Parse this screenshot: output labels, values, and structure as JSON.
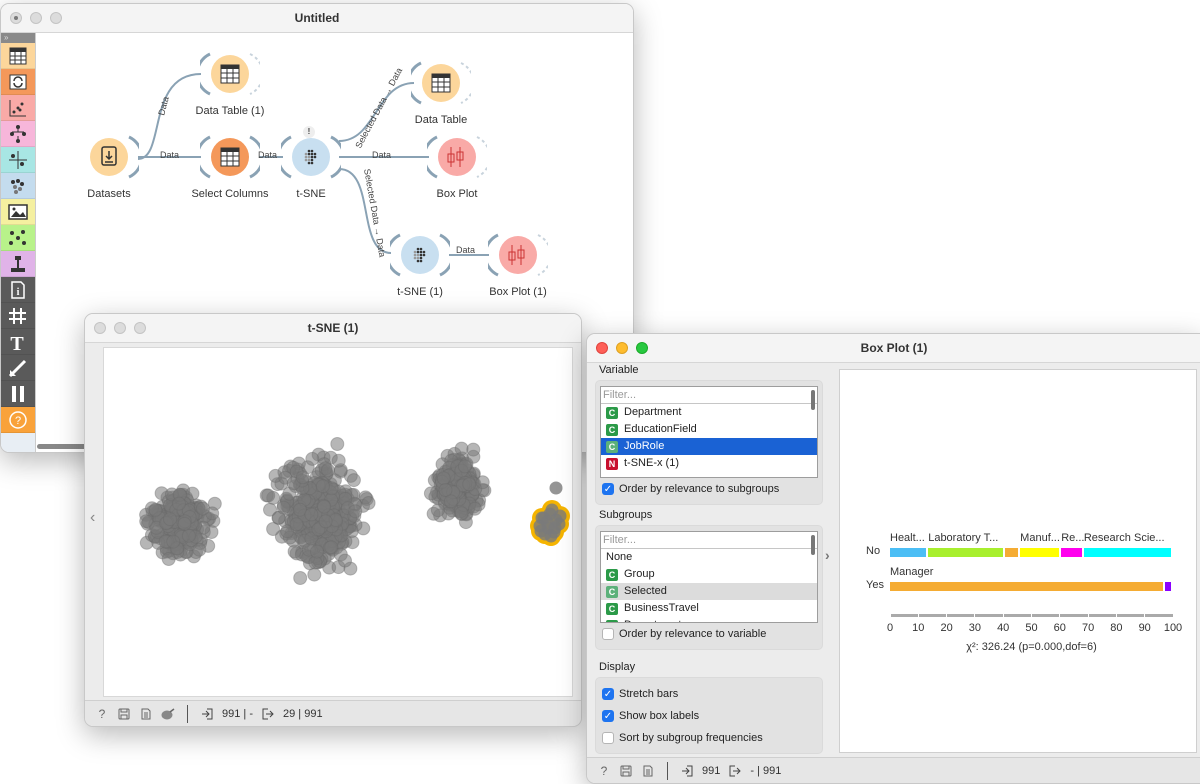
{
  "canvas_window": {
    "title": "Untitled",
    "toolbox_expand": "»",
    "toolbox_items": [
      {
        "name": "data-category",
        "color": "#fcd69b"
      },
      {
        "name": "transform-category",
        "color": "#f4985a"
      },
      {
        "name": "visualize-category",
        "color": "#f9aaa7"
      },
      {
        "name": "model-category",
        "color": "#f7b6da"
      },
      {
        "name": "evaluate-category",
        "color": "#a8e6e4"
      },
      {
        "name": "unsupervised-category",
        "color": "#c4dcee"
      },
      {
        "name": "image-category",
        "color": "#f5f0a0"
      },
      {
        "name": "network-category",
        "color": "#b8f28a"
      },
      {
        "name": "text-category",
        "color": "#e0b3e8"
      },
      {
        "name": "info",
        "color": "#5a5a5a"
      },
      {
        "name": "grid",
        "color": "#5a5a5a"
      },
      {
        "name": "text-annotation",
        "color": "#5a5a5a"
      },
      {
        "name": "arrow-annotation",
        "color": "#5a5a5a"
      },
      {
        "name": "pause",
        "color": "#5a5a5a"
      },
      {
        "name": "help",
        "color": "#f9a23a"
      }
    ],
    "nodes": [
      {
        "label": "Datasets",
        "color": "#fcd69b"
      },
      {
        "label": "Data Table (1)",
        "color": "#fcd69b"
      },
      {
        "label": "Select Columns",
        "color": "#f4985a"
      },
      {
        "label": "t-SNE",
        "color": "#c8dff0"
      },
      {
        "label": "Data Table",
        "color": "#fcd69b"
      },
      {
        "label": "Box Plot",
        "color": "#f9aaa7"
      },
      {
        "label": "t-SNE (1)",
        "color": "#c8dff0"
      },
      {
        "label": "Box Plot (1)",
        "color": "#f9aaa7"
      }
    ],
    "links": [
      {
        "label": "Data"
      },
      {
        "label": "Data"
      },
      {
        "label": "Data"
      },
      {
        "label": "Selected Data → Data"
      },
      {
        "label": "Data"
      },
      {
        "label": "Selected Data → Data"
      },
      {
        "label": "Data"
      }
    ],
    "warning_mark": "!"
  },
  "tsne_window": {
    "title": "t-SNE (1)",
    "side_arrow": "‹",
    "status": {
      "input_count": "991 | -",
      "output_count": "29 | 991"
    },
    "colors": {
      "point": "#7a7a7a",
      "selection": "#f5b400"
    }
  },
  "boxplot_window": {
    "title": "Box Plot (1)",
    "variable": {
      "title": "Variable",
      "filter_placeholder": "Filter...",
      "items": [
        {
          "type": "C",
          "label": "Department",
          "state": ""
        },
        {
          "type": "C",
          "label": "EducationField",
          "state": ""
        },
        {
          "type": "C",
          "label": "JobRole",
          "state": "selected"
        },
        {
          "type": "N",
          "label": "t-SNE-x (1)",
          "state": ""
        }
      ],
      "order_checkbox": {
        "label": "Order by relevance to subgroups",
        "checked": true
      }
    },
    "subgroups": {
      "title": "Subgroups",
      "filter_placeholder": "Filter...",
      "items": [
        {
          "type": "",
          "label": "None",
          "state": ""
        },
        {
          "type": "C",
          "label": "Group",
          "state": ""
        },
        {
          "type": "C",
          "label": "Selected",
          "state": "highlighted"
        },
        {
          "type": "C",
          "label": "BusinessTravel",
          "state": ""
        },
        {
          "type": "C",
          "label": "Department",
          "state": ""
        }
      ],
      "order_checkbox": {
        "label": "Order by relevance to variable",
        "checked": false
      }
    },
    "display": {
      "title": "Display",
      "options": [
        {
          "label": "Stretch bars",
          "checked": true
        },
        {
          "label": "Show box labels",
          "checked": true
        },
        {
          "label": "Sort by subgroup frequencies",
          "checked": false
        }
      ]
    },
    "expand_arrow": "›",
    "status": {
      "input_count": "991",
      "output_count": "- | 991"
    }
  },
  "chart_data": {
    "type": "bar",
    "orientation": "horizontal-stacked-percent",
    "categories": [
      "No",
      "Yes"
    ],
    "series": [
      {
        "name": "Healthcare Representative",
        "label": "Healt...",
        "color": "#4bbef5",
        "values": [
          13.5,
          0
        ]
      },
      {
        "name": "Laboratory Technician",
        "label": "Laboratory T...",
        "color": "#a8ef2e",
        "values": [
          27,
          0
        ]
      },
      {
        "name": "Manager",
        "label": "Manager",
        "color": "#f5ac33",
        "values": [
          5.5,
          97
        ]
      },
      {
        "name": "Manufacturing Director",
        "label": "Manuf...",
        "color": "#ffff00",
        "values": [
          14.5,
          0
        ]
      },
      {
        "name": "Research Director",
        "label": "Re...",
        "color": "#ff00ee",
        "values": [
          8,
          3
        ]
      },
      {
        "name": "Research Scientist",
        "label": "Research Scie...",
        "color": "#00ffff",
        "values": [
          31.5,
          0
        ]
      }
    ],
    "yes_extra_color": "#8b00ff",
    "xlim": [
      0,
      100
    ],
    "xticks": [
      "0",
      "10",
      "20",
      "30",
      "40",
      "50",
      "60",
      "70",
      "80",
      "90",
      "100"
    ],
    "stat_text": "χ²: 326.24 (p=0.000,dof=6)"
  }
}
